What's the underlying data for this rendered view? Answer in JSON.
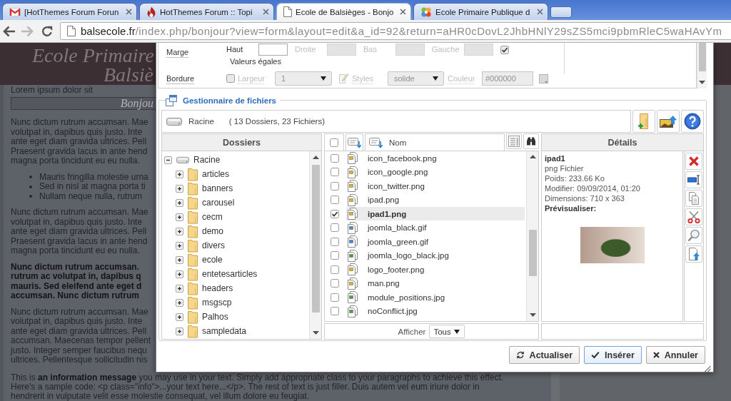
{
  "browser": {
    "tabs": [
      {
        "title": "[HotThemes Forum Forun",
        "kind": "mail",
        "selected": false
      },
      {
        "title": "HotThemes Forum :: Topi",
        "kind": "flame",
        "selected": false
      },
      {
        "title": "Ecole de Balsièges - Bonjo",
        "kind": "page",
        "selected": true
      },
      {
        "title": "Ecole Primaire Publique d",
        "kind": "pinwheel",
        "selected": false
      }
    ],
    "back": {
      "disabled": false
    },
    "forward": {
      "disabled": true
    },
    "address": {
      "host": "balsecole.fr",
      "path": "/index.php/bonjour?view=form&layout=edit&a_id=92&return=aHR0cDovL2JhbHNlY29sZS5mci9pbmRleC5waHAvYm"
    }
  },
  "page": {
    "title": [
      "Ecole Primaire",
      "Balsiè"
    ],
    "intro": "Lorem ipsum dolor sit",
    "banner": "Bonjou",
    "blocks": [
      {
        "kind": "text",
        "lines": [
          "Nunc dictum rutrum accumsan. Mae",
          "volutpat in, dapibus quis justo. Inte",
          "ante eget diam gravida ultrices. Pell",
          "Praesent gravida lacus in ante hend",
          "magna porta tincidunt eu eu nulla."
        ]
      },
      {
        "kind": "bullets",
        "lines": [
          "Mauris fringilla molestie urna",
          "Sed in nisl at magna porta ti",
          "Nullam neque nulla, rutrum"
        ]
      },
      {
        "kind": "text",
        "lines": [
          "Nunc dictum rutrum accumsan. Mae",
          "volutpat in, dapibus quis justo. Inte",
          "ante eget diam gravida ultrices. Pell",
          "Praesent gravida lacus in ante hend",
          "magna porta tincidunt eu eu nulla."
        ]
      },
      {
        "kind": "bold",
        "lines": [
          "Nunc dictum rutrum accumsan.",
          "rutrum ac volutpat in, dapibus q",
          "mauris. Sed eleifend ante eget d",
          "accumsan. Nunc dictum rutrum"
        ]
      },
      {
        "kind": "text",
        "lines": [
          "Nunc dictum rutrum accumsan. Mae",
          "volutpat in, dapibus quis justo. Inte",
          "ante eget diam gravida ultrices. Pell",
          "accumsan. Maecenas tempor pellent",
          "justo. Integer semper faucibus nequ",
          "ultrices. Pellentesque sollicitudin nis"
        ]
      },
      {
        "kind": "notice",
        "lines": [
          "This is **an information message** you may use in your text. Simply add appropriate class to your paragraphs to achieve this effect.",
          "Here's a sample code: <p class=\"info\">...your text here...</p>. The rest of text is just filler. Duis autem vel eum iriure dolor in",
          "hendrerit in vulputate velit esse molestie consequat, vel illum dolore eu feugiat."
        ]
      }
    ]
  },
  "dialog": {
    "form": {
      "margin": {
        "label": "Marge",
        "sides": [
          {
            "label": "Haut",
            "disabled": false
          },
          {
            "label": "Droite",
            "disabled": true
          },
          {
            "label": "Bas",
            "disabled": true
          },
          {
            "label": "Gauche",
            "disabled": true
          }
        ],
        "equal": {
          "label": "Valeurs égales",
          "checked": true
        }
      },
      "border": {
        "label": "Bordure",
        "checked": false,
        "width": {
          "label": "Largeur",
          "value": "1"
        },
        "style": {
          "label": "Styles",
          "value": "solide"
        },
        "color": {
          "label": "Couleur",
          "value": "#000000"
        }
      }
    },
    "file_manager": {
      "title": "Gestionnaire de fichiers",
      "location": "Racine",
      "summary": "( 13 Dossiers, 23 Fichiers)",
      "folders_header": "Dossiers",
      "name_header": "Nom",
      "all_checked": false,
      "tree": [
        {
          "name": "Racine",
          "kind": "drive",
          "expanded": true,
          "children": [
            {
              "name": "articles",
              "kind": "folder",
              "expanded": false
            },
            {
              "name": "banners",
              "kind": "folder",
              "expanded": false
            },
            {
              "name": "carousel",
              "kind": "folder",
              "expanded": false
            },
            {
              "name": "cecm",
              "kind": "folder",
              "expanded": false
            },
            {
              "name": "demo",
              "kind": "folder",
              "expanded": false
            },
            {
              "name": "divers",
              "kind": "folder",
              "expanded": false
            },
            {
              "name": "ecole",
              "kind": "folder",
              "expanded": false
            },
            {
              "name": "entetesarticles",
              "kind": "folder",
              "expanded": false
            },
            {
              "name": "headers",
              "kind": "folder",
              "expanded": false
            },
            {
              "name": "msgscp",
              "kind": "folder",
              "expanded": false
            },
            {
              "name": "Palhos",
              "kind": "folder",
              "expanded": false
            },
            {
              "name": "sampledata",
              "kind": "folder",
              "expanded": false
            }
          ]
        }
      ],
      "files": [
        {
          "name": "icon_facebook.png",
          "kind": "png",
          "checked": false,
          "selected": false
        },
        {
          "name": "icon_google.png",
          "kind": "png",
          "checked": false,
          "selected": false
        },
        {
          "name": "icon_twitter.png",
          "kind": "png",
          "checked": false,
          "selected": false
        },
        {
          "name": "ipad.png",
          "kind": "png",
          "checked": false,
          "selected": false
        },
        {
          "name": "ipad1.png",
          "kind": "png",
          "checked": true,
          "selected": true
        },
        {
          "name": "joomla_black.gif",
          "kind": "gif",
          "checked": false,
          "selected": false
        },
        {
          "name": "joomla_green.gif",
          "kind": "gif",
          "checked": false,
          "selected": false
        },
        {
          "name": "joomla_logo_black.jpg",
          "kind": "jpg",
          "checked": false,
          "selected": false
        },
        {
          "name": "logo_footer.png",
          "kind": "png",
          "checked": false,
          "selected": false
        },
        {
          "name": "man.png",
          "kind": "png",
          "checked": false,
          "selected": false
        },
        {
          "name": "module_positions.jpg",
          "kind": "jpg",
          "checked": false,
          "selected": false
        },
        {
          "name": "noConflict.jpg",
          "kind": "jpg",
          "checked": false,
          "selected": false
        }
      ],
      "filter": {
        "label": "Afficher",
        "value": "Tous"
      },
      "details_header": "Détails",
      "details": {
        "name": "ipad1",
        "lines": [
          "png Fichier",
          "Poids: 233.66 Ko",
          "Modifier: 09/09/2014, 01:20",
          "Dimensions: 710 x 363"
        ],
        "preview_label": "Prévisualiser:"
      }
    },
    "buttons": [
      {
        "label": "Actualiser",
        "kind": "refresh",
        "primary": false
      },
      {
        "label": "Insérer",
        "kind": "insert",
        "primary": true
      },
      {
        "label": "Annuler",
        "kind": "cancel",
        "primary": false
      }
    ]
  }
}
